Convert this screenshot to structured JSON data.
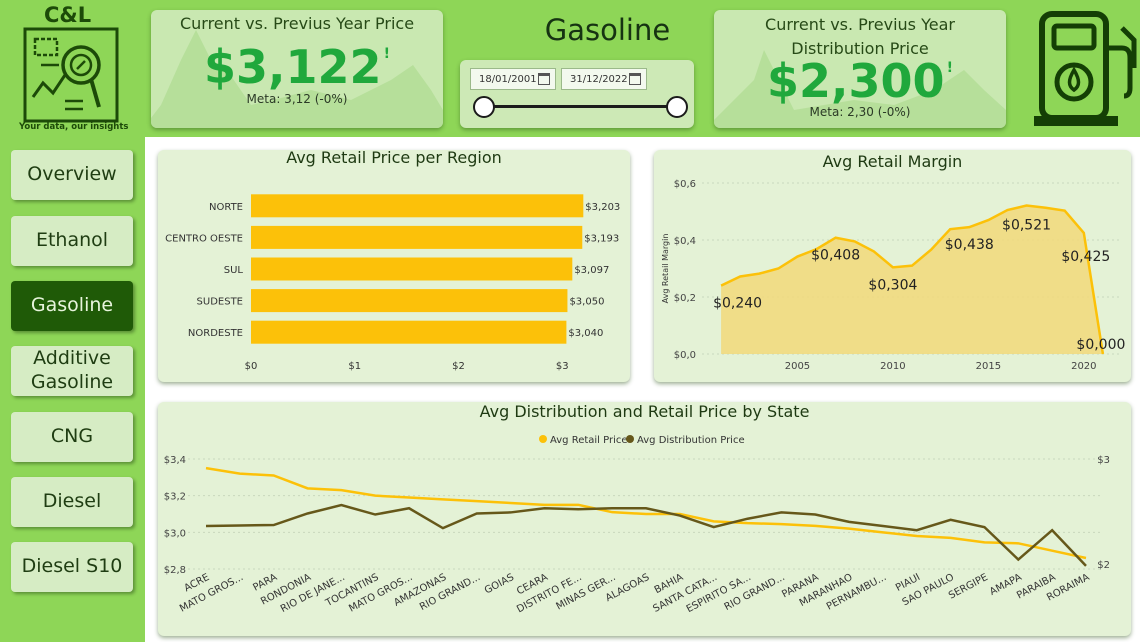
{
  "logo": {
    "brand": "C&L",
    "tagline": "Your data, our insights"
  },
  "page_title": "Gasoline",
  "kpi_price": {
    "title": "Current vs. Previus Year Price",
    "value": "$3,122",
    "indicator": "!",
    "meta": "Meta: 3,12 (-0%)"
  },
  "kpi_distribution": {
    "title": "Current vs. Previus Year Distribution Price",
    "value": "$2,300",
    "indicator": "!",
    "meta": "Meta: 2,30 (-0%)"
  },
  "date_filter": {
    "start": "18/01/2001",
    "end": "31/12/2022",
    "start_fraction": 0,
    "end_fraction": 1
  },
  "nav": [
    "Overview",
    "Ethanol",
    "Gasoline",
    "Additive Gasoline",
    "CNG",
    "Diesel",
    "Diesel S10"
  ],
  "nav_active": "Gasoline",
  "colors": {
    "retail": "#fcc109",
    "distribution": "#66581a",
    "active_nav": "#1f5a07",
    "kpi_value": "#20a83c",
    "background": "#8ed657"
  },
  "chart_data": [
    {
      "type": "bar",
      "orientation": "horizontal",
      "title": "Avg Retail Price per Region",
      "categories": [
        "NORTE",
        "CENTRO OESTE",
        "SUL",
        "SUDESTE",
        "NORDESTE"
      ],
      "values": [
        3.203,
        3.193,
        3.097,
        3.05,
        3.04
      ],
      "data_labels": [
        "$3,203",
        "$3,193",
        "$3,097",
        "$3,050",
        "$3,040"
      ],
      "x_ticks": [
        "$0",
        "$1",
        "$2",
        "$3"
      ],
      "xlim": [
        0,
        3.2
      ],
      "grid": false
    },
    {
      "type": "area",
      "title": "Avg Retail Margin",
      "ylabel": "Avg Retail Margin",
      "x": [
        2001,
        2002,
        2003,
        2004,
        2005,
        2006,
        2007,
        2008,
        2009,
        2010,
        2011,
        2012,
        2013,
        2014,
        2015,
        2016,
        2017,
        2018,
        2019,
        2020,
        2021
      ],
      "y": [
        0.24,
        0.272,
        0.282,
        0.3,
        0.342,
        0.368,
        0.408,
        0.395,
        0.36,
        0.304,
        0.31,
        0.366,
        0.438,
        0.445,
        0.47,
        0.505,
        0.521,
        0.513,
        0.503,
        0.425,
        0.0
      ],
      "point_labels": [
        {
          "x": 2001,
          "text": "$0,240"
        },
        {
          "x": 2007,
          "text": "$0,408"
        },
        {
          "x": 2010,
          "text": "$0,304"
        },
        {
          "x": 2014,
          "text": "$0,438"
        },
        {
          "x": 2017,
          "text": "$0,521"
        },
        {
          "x": 2020,
          "text": "$0,425"
        },
        {
          "x": 2021,
          "text": "$0,000"
        }
      ],
      "y_ticks": [
        "$0,0",
        "$0,2",
        "$0,4",
        "$0,6"
      ],
      "x_ticks": [
        "2005",
        "2010",
        "2015",
        "2020"
      ],
      "ylim": [
        0,
        0.6
      ],
      "xlim": [
        2000,
        2022
      ],
      "grid": true
    },
    {
      "type": "line",
      "title": "Avg Distribution and Retail Price by State",
      "legend_position": "top-center",
      "categories": [
        "ACRE",
        "MATO GROS...",
        "PARA",
        "RONDONIA",
        "RIO DE JANE...",
        "TOCANTINS",
        "MATO GROS...",
        "AMAZONAS",
        "RIO GRAND...",
        "GOIAS",
        "CEARA",
        "DISTRITO FE...",
        "MINAS GER...",
        "ALAGOAS",
        "BAHIA",
        "SANTA CATA...",
        "ESPIRITO SA...",
        "RIO GRAND...",
        "PARANA",
        "MARANHAO",
        "PERNAMBU...",
        "PIAUI",
        "SAO PAULO",
        "SERGIPE",
        "AMAPA",
        "PARAIBA",
        "RORAIMA"
      ],
      "series": [
        {
          "name": "Avg Retail Price",
          "axis": "left",
          "values": [
            3.35,
            3.32,
            3.31,
            3.24,
            3.23,
            3.2,
            3.19,
            3.18,
            3.17,
            3.16,
            3.15,
            3.15,
            3.11,
            3.1,
            3.1,
            3.06,
            3.05,
            3.045,
            3.035,
            3.02,
            3.0,
            2.98,
            2.97,
            2.945,
            2.94,
            2.9,
            2.86
          ]
        },
        {
          "name": "Avg Distribution Price",
          "axis": "right",
          "values": [
            2.36,
            2.365,
            2.37,
            2.48,
            2.56,
            2.47,
            2.53,
            2.34,
            2.48,
            2.49,
            2.53,
            2.52,
            2.53,
            2.53,
            2.46,
            2.35,
            2.43,
            2.49,
            2.47,
            2.4,
            2.36,
            2.32,
            2.42,
            2.35,
            2.04,
            2.32,
            1.98
          ]
        }
      ],
      "y_ticks_left": [
        "$2,8",
        "$3,0",
        "$3,2",
        "$3,4"
      ],
      "ylim_left": [
        2.8,
        3.4
      ],
      "y_ticks_right": [
        "$2",
        "$3"
      ],
      "ylim_right": [
        1.95,
        3.0
      ],
      "grid": true
    }
  ]
}
